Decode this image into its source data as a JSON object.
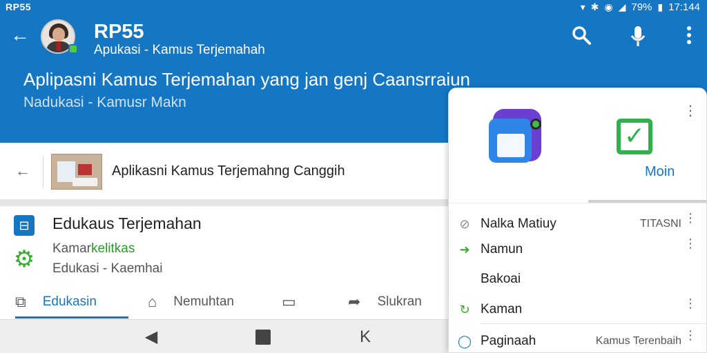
{
  "status_bar": {
    "left_text": "RP55",
    "battery": "79%",
    "time": "17:144"
  },
  "header": {
    "title": "RP55",
    "subtitle": "Apukasi - Kamus Terjemahah",
    "headline": "Aplipasni Kamus Terjemahan yang jan genj Caansrraiun",
    "subline": "Nadukasi - Kamusr Makn"
  },
  "article": {
    "title": "Aplikasni Kamus Terjemahng Canggih"
  },
  "list": {
    "title": "Edukaus Terjemahan",
    "line1_a": "Kamar",
    "line1_b": "kelitkas",
    "line2": "Edukasi - Kaemhai"
  },
  "tabs": [
    {
      "label": "Edukasin",
      "icon": "image-icon"
    },
    {
      "label": "Nemuhtan",
      "icon": "home-icon"
    },
    {
      "label": "",
      "icon": "comment-icon"
    },
    {
      "label": "Slukran",
      "icon": "share-icon"
    }
  ],
  "panel": {
    "app_label": "Moin",
    "rows": [
      {
        "label": "Nalka Matiuy",
        "right": "TITASNI",
        "icon": "search-icon"
      },
      {
        "label": "Namun",
        "right": "",
        "icon": "arrow-icon"
      },
      {
        "label": "Bakoai",
        "right": "",
        "icon": ""
      },
      {
        "label": "Kaman",
        "right": "",
        "icon": "refresh-icon"
      },
      {
        "label": "Paginaah",
        "right": "Kamus Terenbaih",
        "icon": "circle-icon"
      }
    ]
  },
  "colors": {
    "primary": "#1577c4",
    "accent_green": "#36b02c"
  }
}
